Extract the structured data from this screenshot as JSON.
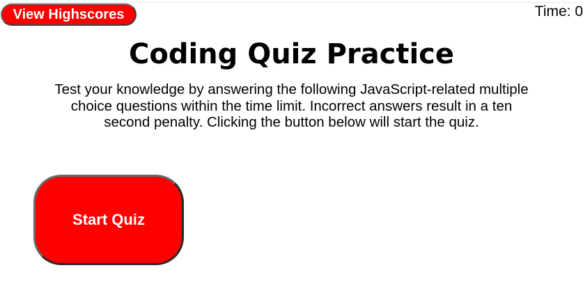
{
  "header": {
    "highscores_label": "View Highscores",
    "timer_text": "Time: 0"
  },
  "main": {
    "title": "Coding Quiz Practice",
    "intro_lines": [
      "Test your knowledge by answering the following JavaScript-related multiple",
      "choice questions within the time limit. Incorrect answers result in a ten",
      "second penalty. Clicking the button below will start the quiz."
    ],
    "start_label": "Start Quiz"
  },
  "colors": {
    "accent": "#ff0000",
    "button_text": "#ffffff",
    "text": "#000000",
    "background": "#ffffff"
  }
}
